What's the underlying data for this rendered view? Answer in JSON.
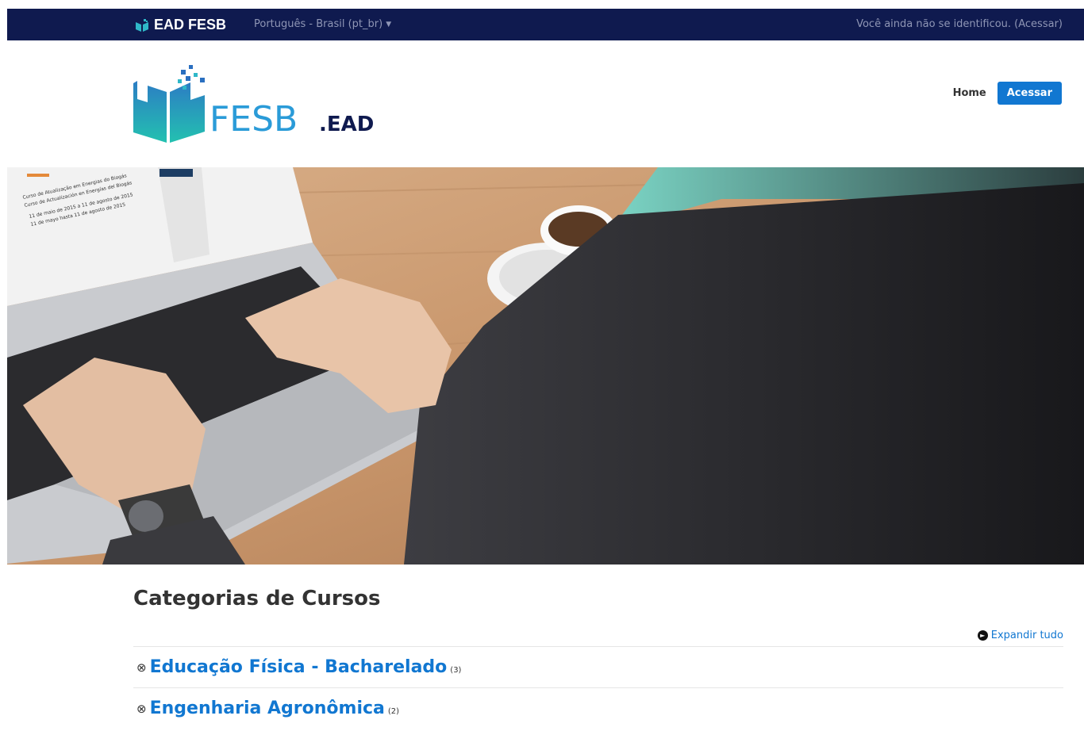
{
  "topbar": {
    "brand": "EAD FESB",
    "language": "Português - Brasil (pt_br)",
    "login_status": "Você ainda não se identificou. (Acessar)"
  },
  "header": {
    "logo_text_main": "FESB",
    "logo_text_suffix": ".EAD",
    "nav_home": "Home",
    "nav_login": "Acessar"
  },
  "hero": {
    "screen_lines": [
      "Curso de Atualização em Energias do Biogás",
      "Curso de Actualización en Energías del Biogás",
      "11 de maio de 2015 a 11 de agosto de 2015",
      "11 de mayo hasta 11 de agosto de 2015"
    ]
  },
  "categories": {
    "title": "Categorias de Cursos",
    "expand_all": "Expandir tudo",
    "items": [
      {
        "name": "Educação Física - Bacharelado",
        "count": "(3)"
      },
      {
        "name": "Engenharia Agronômica",
        "count": "(2)"
      }
    ]
  },
  "colors": {
    "topbar": "#0f1a4f",
    "accent": "#1177d1"
  }
}
